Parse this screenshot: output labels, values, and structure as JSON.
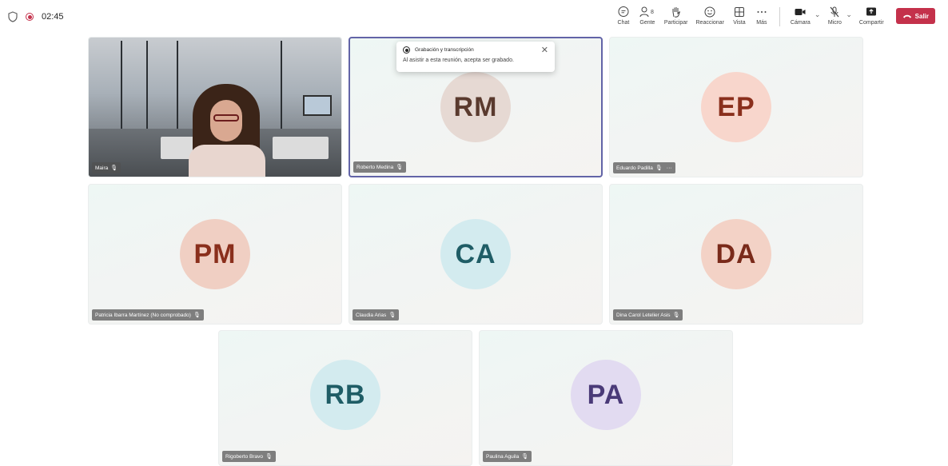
{
  "header": {
    "timer": "02:45",
    "buttons": [
      {
        "id": "chat",
        "label": "Chat",
        "icon": "chat-icon"
      },
      {
        "id": "people",
        "label": "Gente",
        "icon": "people-icon",
        "count": "8"
      },
      {
        "id": "raise",
        "label": "Participar",
        "icon": "raise-hand-icon"
      },
      {
        "id": "react",
        "label": "Reaccionar",
        "icon": "smiley-icon"
      },
      {
        "id": "view",
        "label": "Vista",
        "icon": "grid-view-icon"
      },
      {
        "id": "more",
        "label": "Más",
        "icon": "more-icon"
      }
    ],
    "camera_label": "Cámara",
    "mic_label": "Micro",
    "share_label": "Compartir",
    "leave_label": "Salir"
  },
  "toast": {
    "title": "Grabación y transcripción",
    "body": "Al asistir a esta reunión, acepta ser grabado."
  },
  "tiles": [
    {
      "name": "Maira",
      "initials": "",
      "video": true
    },
    {
      "name": "Roberto Medina",
      "initials": "RM",
      "avatar_bg": "#e6d9d3",
      "initials_color": "#5a3a2e"
    },
    {
      "name": "Eduardo Padilla",
      "initials": "EP",
      "avatar_bg": "#f8d6cc",
      "initials_color": "#8a2f1c"
    },
    {
      "name": "Patricia Ibarra Martínez (No comprobado)",
      "initials": "PM",
      "avatar_bg": "#f0cfc3",
      "initials_color": "#8a2f1c"
    },
    {
      "name": "Claudia Arias",
      "initials": "CA",
      "avatar_bg": "#d3ebef",
      "initials_color": "#1f5d66"
    },
    {
      "name": "Dina Carol Letelier Asis",
      "initials": "DA",
      "avatar_bg": "#f3d2c6",
      "initials_color": "#7a2a1a"
    },
    {
      "name": "Rigoberto Bravo",
      "initials": "RB",
      "avatar_bg": "#d3ebef",
      "initials_color": "#1f5d66"
    },
    {
      "name": "Paulina Aguila",
      "initials": "PA",
      "avatar_bg": "#e2dbf1",
      "initials_color": "#4a3a78"
    }
  ],
  "colors": {
    "accent": "#6264a7",
    "leave": "#c4314b"
  }
}
